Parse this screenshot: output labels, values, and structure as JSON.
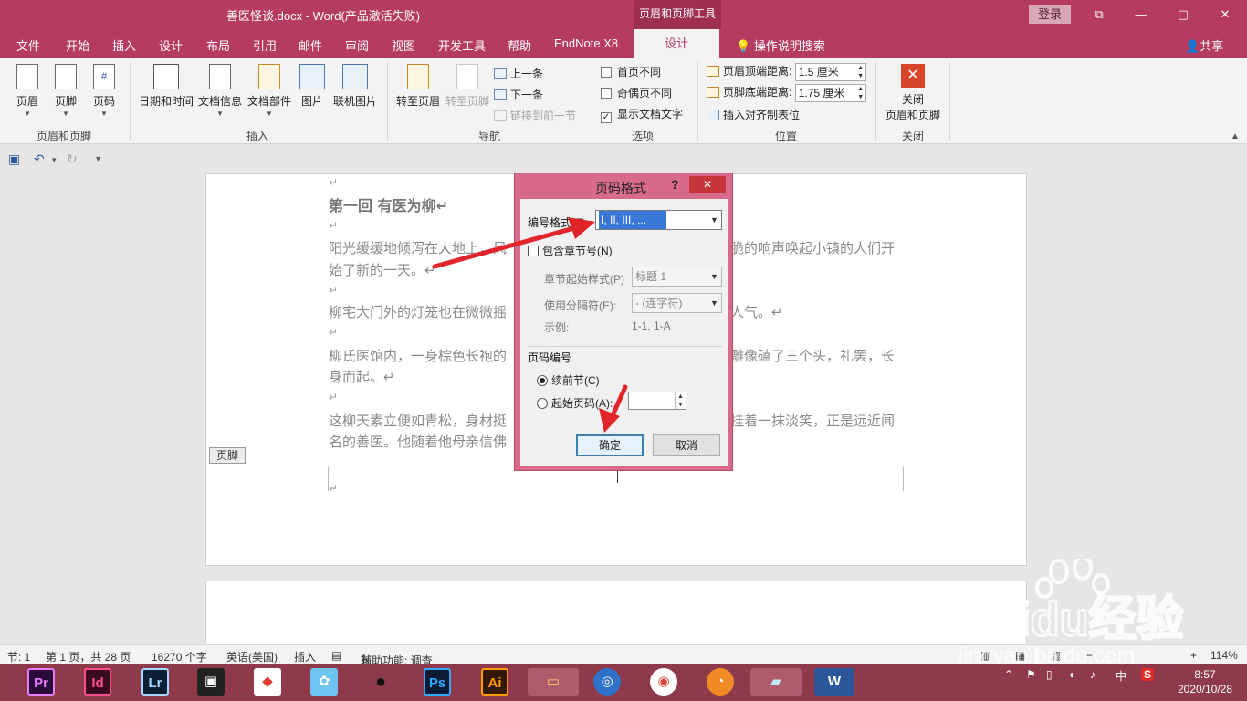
{
  "titlebar": {
    "document_title": "善医怪谈.docx  -  Word(产品激活失败)",
    "context_tool_title": "页眉和页脚工具",
    "login_label": "登录",
    "window_buttons": [
      "⧉",
      "—",
      "▢",
      "✕"
    ]
  },
  "tabs": [
    "文件",
    "开始",
    "插入",
    "设计",
    "布局",
    "引用",
    "邮件",
    "审阅",
    "视图",
    "开发工具",
    "帮助",
    "EndNote X8",
    "设计"
  ],
  "tell_me": "操作说明搜索",
  "share": "共享",
  "ribbon": {
    "group_header_footer": {
      "label": "页眉和页脚",
      "buttons": [
        "页眉",
        "页脚",
        "页码"
      ]
    },
    "group_insert": {
      "label": "插入",
      "buttons": [
        "日期和时间",
        "文档信息",
        "文档部件",
        "图片",
        "联机图片"
      ]
    },
    "group_nav": {
      "label": "导航",
      "goto_header": "转至页眉",
      "goto_footer": "转至页脚",
      "previous": "上一条",
      "next": "下一条",
      "link_previous": "链接到前一节"
    },
    "group_options": {
      "label": "选项",
      "different_first": "首页不同",
      "different_odd_even": "奇偶页不同",
      "show_doc_text": "显示文档文字",
      "show_doc_text_checked": true
    },
    "group_position": {
      "label": "位置",
      "header_top_label": "页眉顶端距离:",
      "header_top_value": "1.5 厘米",
      "footer_bottom_label": "页脚底端距离:",
      "footer_bottom_value": "1.75 厘米",
      "insert_align_tab": "插入对齐制表位"
    },
    "group_close": {
      "label": "关闭",
      "close_button_line1": "关闭",
      "close_button_line2": "页眉和页脚"
    }
  },
  "document": {
    "para_mark": "↵",
    "heading": "第一回  有医为柳↵",
    "p1_line1": "阳光缓缓地倾泻在大地上，风",
    "p1_line1_right": "脆的响声唤起小镇的人们开",
    "p1_line2": "始了新的一天。↵",
    "p2_line1": "柳宅大门外的灯笼也在微微摇",
    "p2_line1_right": "人气。↵",
    "p3_line1": "柳氏医馆内，一身棕色长袍的",
    "p3_line1_right": "雕像磕了三个头，礼罢，长",
    "p3_line2": "身而起。↵",
    "p4_line1": "这柳天素立便如青松，身材挺",
    "p4_line1_right": "挂着一抹淡笑，正是远近闻",
    "p4_line2": "名的善医。他随着他母亲信佛",
    "footer_tag": "页脚"
  },
  "dialog": {
    "title": "页码格式",
    "help": "?",
    "close": "✕",
    "number_format_label": "编号格式(F):",
    "number_format_value": "I, II, III, ...",
    "include_chapter_label": "包含章节号(N)",
    "chapter_style_label": "章节起始样式(P)",
    "chapter_style_value": "标题 1",
    "separator_label": "使用分隔符(E):",
    "separator_value": "-  (连字符)",
    "example_label": "示例:",
    "example_value": "1-1, 1-A",
    "page_numbering_label": "页码编号",
    "continue_label": "续前节(C)",
    "start_at_label": "起始页码(A):",
    "ok": "确定",
    "cancel": "取消"
  },
  "statusbar": {
    "section": "节: 1",
    "page": "第 1 页，共 28 页",
    "words": "16270 个字",
    "language": "英语(美国)",
    "mode": "插入",
    "accessibility": "辅助功能: 调查",
    "zoom": "114%"
  },
  "watermark": {
    "brand": "Baidu经验",
    "url": "jingyan.baidu.com"
  },
  "taskbar": {
    "apps": [
      "Pr",
      "Id",
      "Lr",
      "Ai",
      "Ps"
    ],
    "ime": "中",
    "time": "8:57",
    "date": "2020/10/28"
  }
}
